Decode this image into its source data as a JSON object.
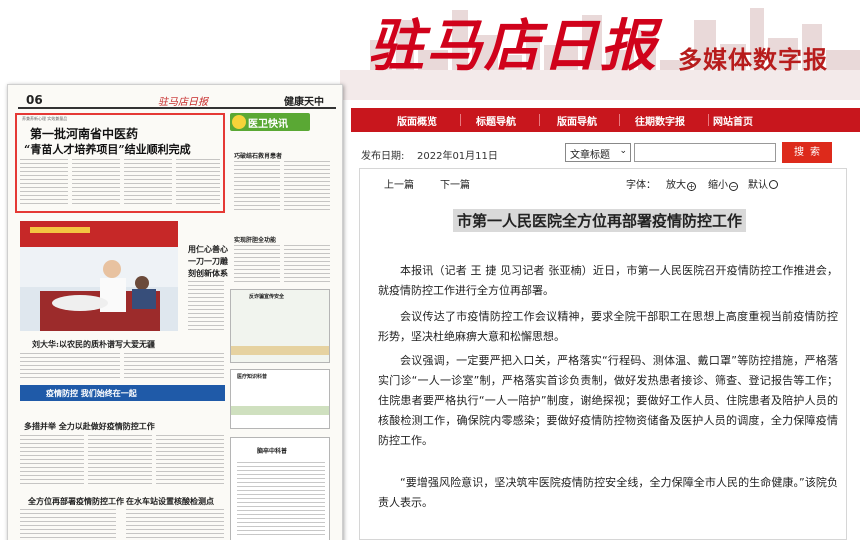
{
  "header": {
    "brand_title": "驻马店日报",
    "brand_subtitle": "多媒体数字报"
  },
  "paper_page": {
    "page_number": "06",
    "section_name": "健康天中",
    "masthead_logo": "驻马店日报",
    "lead_tag": "养兼养新心理  实效兼量品",
    "lead_title_line1": "第一批河南省中医药",
    "lead_title_line2": "“青苗人才培养项目”结业顺利完成",
    "health_banner": "医卫快讯",
    "side_story1": "巧破结石救肖患者",
    "side_story2": "实现肝胆全功能",
    "photo_caption": "刘大华:以农民的质朴谱写大爱无疆",
    "right_headline": "用仁心善心一刀一刀雕刻创新体系",
    "blue_banner": "疫情防控  我们始终在一起",
    "story_headline_1": "多措并举  全力以赴做好疫情防控工作",
    "story_headline_2": "全方位再部署疫情防控工作",
    "story_headline_3": "在水车站设置核酸检测点",
    "box_title_1": "反诈骗宣传安全",
    "box_title_2": "医疗知识科普",
    "box_title_3": "脑卒中科普"
  },
  "nav": {
    "items": [
      "版面概览",
      "标题导航",
      "版面导航",
      "往期数字报",
      "网站首页"
    ]
  },
  "search": {
    "pub_label": "发布日期:",
    "pub_date": "2022年01月11日",
    "type_select": "文章标题",
    "input_value": "",
    "button_label": "搜索"
  },
  "toolbar": {
    "prev": "上一篇",
    "next": "下一篇",
    "font_label": "字体：",
    "zoom_in": "放大",
    "zoom_out": "缩小",
    "default": "默认"
  },
  "article": {
    "title": "市第一人民医院全方位再部署疫情防控工作",
    "paragraphs": [
      "本报讯（记者 王 捷 见习记者 张亚楠）近日，市第一人民医院召开疫情防控工作推进会，就疫情防控工作进行全方位再部署。",
      "会议传达了市疫情防控工作会议精神，要求全院干部职工在思想上高度重视当前疫情防控形势，坚决杜绝麻痹大意和松懈思想。",
      "会议强调，一定要严把入口关，严格落实“行程码、测体温、戴口罩”等防控措施，严格落实门诊“一人一诊室”制，严格落实首诊负责制，做好发热患者接诊、筛查、登记报告等工作；住院患者要严格执行“一人一陪护”制度，谢绝探视；要做好工作人员、住院患者及陪护人员的核酸检测工作，确保院内零感染；要做好疫情防控物资储备及医护人员的调度，全力保障疫情防控工作。",
      "“要增强风险意识，坚决筑牢医院疫情防控安全线，全力保障全市人民的生命健康。”该院负责人表示。"
    ]
  }
}
